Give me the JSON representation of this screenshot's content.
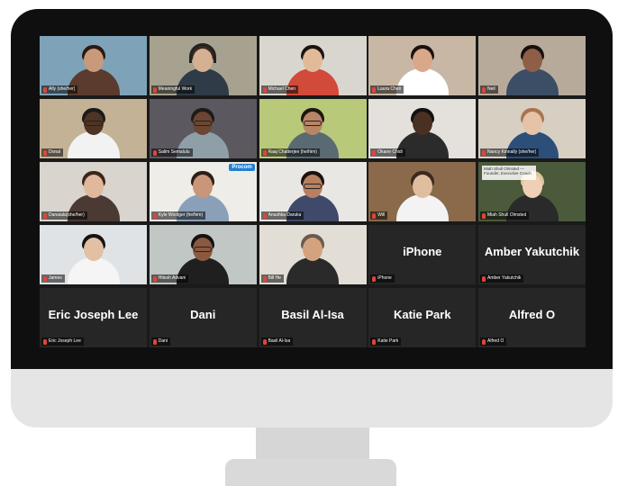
{
  "participants": [
    {
      "name": "Ally (she/her)",
      "video": true,
      "bg": "#7ea3b8",
      "skin": "#c99a7a",
      "hair": "#2a1a12",
      "shirt": "#5b3b2e",
      "glasses": false
    },
    {
      "name": "Meaningful Work",
      "video": true,
      "bg": "#a6a28f",
      "skin": "#d6b093",
      "hair": "#3a2a1e",
      "shirt": "#2f3b46",
      "glasses": false,
      "headset": true,
      "speaking": true
    },
    {
      "name": "Michael Chen",
      "video": true,
      "bg": "#d9d6d0",
      "skin": "#e1bb98",
      "hair": "#1b1511",
      "shirt": "#d24a3a",
      "glasses": false
    },
    {
      "name": "Laura Chen",
      "video": true,
      "bg": "#c8b7a5",
      "skin": "#d9a88a",
      "hair": "#1a120e",
      "shirt": "#ffffff",
      "glasses": false
    },
    {
      "name": "Neil",
      "video": true,
      "bg": "#b8aa9b",
      "skin": "#8e5f46",
      "hair": "#161010",
      "shirt": "#3c4e66",
      "glasses": false
    },
    {
      "name": "Donal",
      "video": true,
      "bg": "#c4b296",
      "skin": "#4e3424",
      "hair": "#1a1a1a",
      "shirt": "#f2f2f2",
      "glasses": true
    },
    {
      "name": "Salim Semalulu",
      "video": true,
      "bg": "#5c5860",
      "skin": "#6b4632",
      "hair": "#1e1a18",
      "shirt": "#8f9fa8",
      "glasses": true
    },
    {
      "name": "Raaj Chatterjee (he/him)",
      "video": true,
      "bg": "#b9c97a",
      "skin": "#b88566",
      "hair": "#1e1511",
      "shirt": "#5a6a72",
      "glasses": true
    },
    {
      "name": "Okane Chidi",
      "video": true,
      "bg": "#e4e1dc",
      "skin": "#4a3022",
      "hair": "#141010",
      "shirt": "#2b2b2b",
      "glasses": false
    },
    {
      "name": "Nancy Kinnally (she/her)",
      "video": true,
      "bg": "#d8cfc3",
      "skin": "#e6c2a8",
      "hair": "#a7744f",
      "shirt": "#2c4f7a",
      "glasses": false
    },
    {
      "name": "Danaiala(she/her)",
      "video": true,
      "bg": "#d9d4cd",
      "skin": "#e0b89b",
      "hair": "#3a261a",
      "shirt": "#4a3a33",
      "glasses": false
    },
    {
      "name": "Kyle Woolger (he/him)",
      "video": true,
      "bg": "#efede8",
      "skin": "#c9967a",
      "hair": "#2e1f16",
      "shirt": "#8aa0b8",
      "glasses": false,
      "badge": "Procom"
    },
    {
      "name": "Anushka Daruka",
      "video": true,
      "bg": "#e9e7e3",
      "skin": "#b98060",
      "hair": "#1b1210",
      "shirt": "#3f4a6a",
      "glasses": true
    },
    {
      "name": "Will",
      "video": true,
      "bg": "#8a6a4a",
      "skin": "#dfbd9f",
      "hair": "#3b2a1e",
      "shirt": "#f3f3f3",
      "glasses": false
    },
    {
      "name": "Miah Shull Olmsted",
      "video": true,
      "bg": "#4a5a3a",
      "skin": "#efcfb6",
      "hair": "#d8c79a",
      "shirt": "#2a2a2a",
      "glasses": false,
      "sign": "Miah Shull Olmsted — Founder, Executive Coach"
    },
    {
      "name": "James",
      "video": true,
      "bg": "#dfe3e6",
      "skin": "#e2c0a4",
      "hair": "#171311",
      "shirt": "#f5f5f5",
      "glasses": false
    },
    {
      "name": "Hitesh Advani",
      "video": true,
      "bg": "#c0c7c5",
      "skin": "#8a5a40",
      "hair": "#151111",
      "shirt": "#1f1f1f",
      "glasses": true
    },
    {
      "name": "Bill He",
      "video": true,
      "bg": "#e2ddd5",
      "skin": "#d3a380",
      "hair": "#6a5a4e",
      "shirt": "#2a2a2a",
      "glasses": false
    },
    {
      "name": "iPhone",
      "video": false
    },
    {
      "name": "Amber Yakutchik",
      "video": false
    },
    {
      "name": "Eric Joseph Lee",
      "video": false
    },
    {
      "name": "Dani",
      "video": false
    },
    {
      "name": "Basil Al-Isa",
      "video": false
    },
    {
      "name": "Katie Park",
      "video": false
    },
    {
      "name": "Alfred O",
      "video": false
    }
  ]
}
